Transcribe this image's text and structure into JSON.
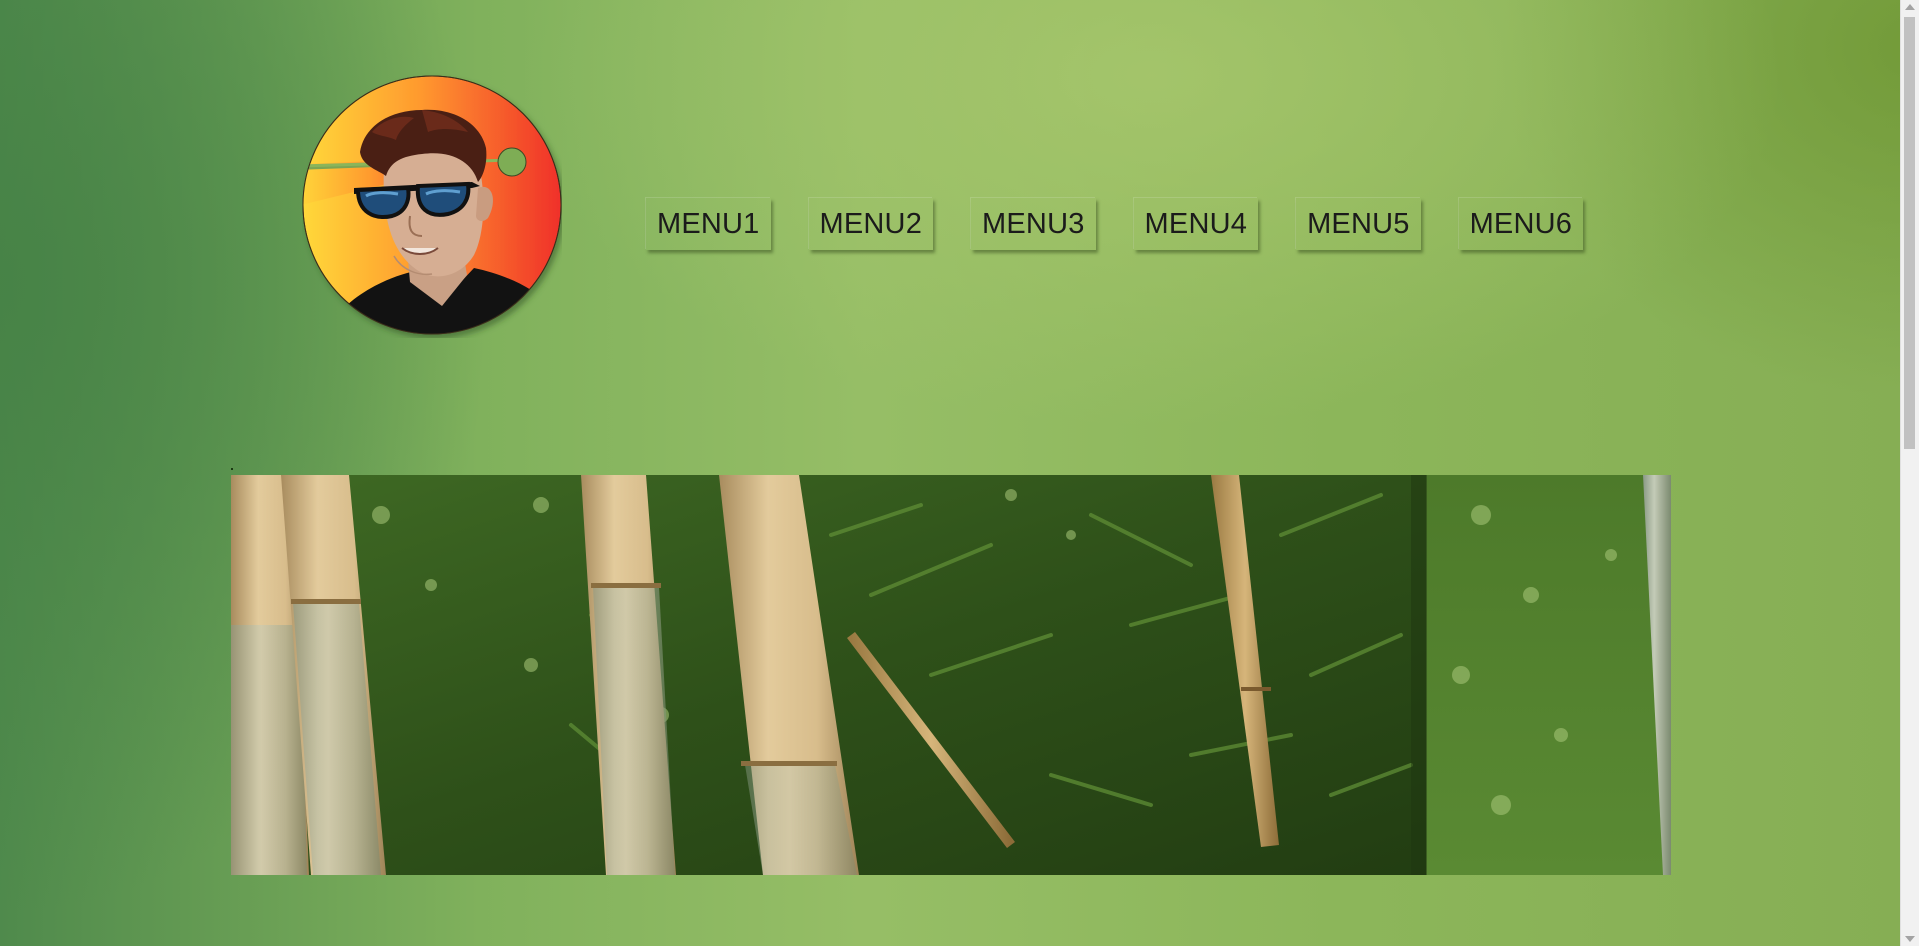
{
  "nav": {
    "items": [
      {
        "label": "MENU1"
      },
      {
        "label": "MENU2"
      },
      {
        "label": "MENU3"
      },
      {
        "label": "MENU4"
      },
      {
        "label": "MENU5"
      },
      {
        "label": "MENU6"
      }
    ]
  },
  "avatar": {
    "icon": "sunglasses-man-avatar-icon"
  },
  "hero": {
    "image": "bamboo-forest-photo"
  },
  "colors": {
    "background": "#8cb65a",
    "menu_text": "#1b1b1b",
    "avatar_gradient_start": "#ffd83a",
    "avatar_gradient_end": "#f0302b"
  }
}
